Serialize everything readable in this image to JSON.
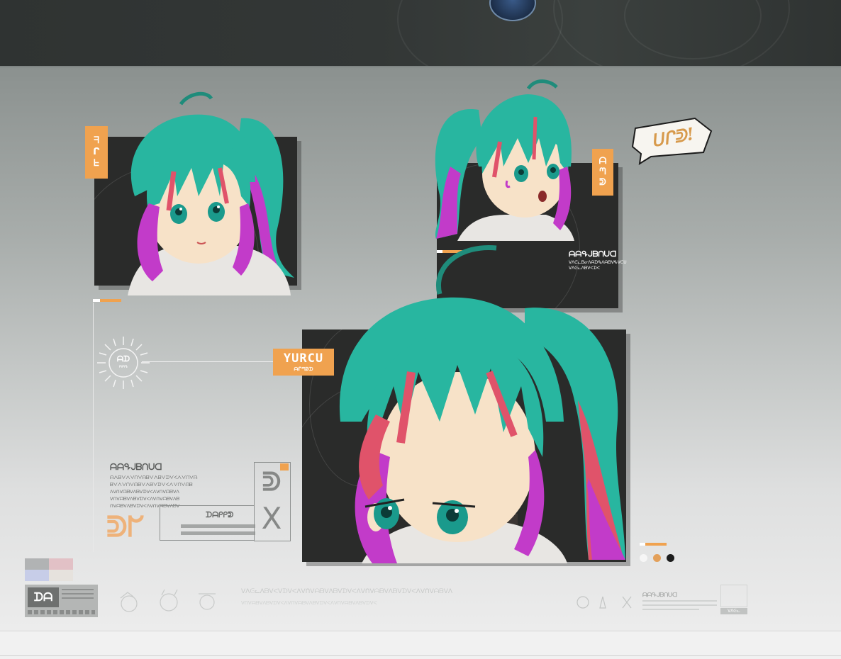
{
  "header": {
    "emblem_icon": "shield-emblem-icon"
  },
  "portrait_small_left": {
    "tag": "ᖷᒋᖶ",
    "hair_color": "#28b6a0",
    "accent_color": "#e0536a",
    "tip_color": "#c23bc9"
  },
  "portrait_small_right": {
    "tag": "ᗩᘉᕲ",
    "speech": "ᑌᒋᕲ!"
  },
  "portrait_main": {
    "tag_title": "YURCU",
    "tag_sub": "ᗩᒋᘉᕲᗪ"
  },
  "caption_top_right": {
    "title": "ᗩᗩᕴᒍᗷᑎᑌᗡ",
    "line1": "ᐯᐱᕮᓚᗷᓂᐱᗩᗪᕴᐱᗩᗷᐯᕴᐯᑕᑌ",
    "line2": "ᐯᐱᕮᓚᐱᗷᐯᐸᗪᐸ"
  },
  "side_block": {
    "title": "ᗩᗩᕴᒍᗷᑎᑌᗡ",
    "lines": [
      "ᗩᐱᗷᐯᐱᐯᑎᐯᗩᗷᐯᐱᗷᐯᗪᐯᐸᐱᐯᑎᐯᗩ",
      "ᗷᐯᐱᐯᑎᐯᗩᗷᐯᐱᗷᐯᗪᐯᐸᐱᐯᑎᐯᗩᗷ",
      "ᐱᐯᑎᐯᗩᗷᐯᐱᗷᐯᗪᐯᐸᐱᐯᑎᐯᗩᗷᐯᐱ",
      "ᐯᑎᐯᗩᗷᐯᐱᗷᐯᗪᐯᐸᐱᐯᑎᐯᗩᗷᐯᐱᗷ",
      "ᑎᐯᗩᗷᐯᐱᗷᐯᗪᐯᐸᐱᐯᑎᐯᗩᗷᐯᐱᗷᐯ"
    ],
    "box_label": "ᗪᗩᑭᑭᕲ",
    "big_mark": "ᕲᖸ",
    "glyph_a": "ᕲ",
    "glyph_b": "X"
  },
  "sun_badge": {
    "label": "ᗩᗪ",
    "sub": "ᗩᗩᕴ"
  },
  "footer": {
    "logo_text": "ᗪᗩ",
    "text_line1": "ᐯᐱᕮᓚᐱᗷᐯᐸᐯᗪᐯᐸᐱᐯᑎᐯᗩᗷᐯᐱᗷᐯᗪᐯᐸᐱᐯᑎᐯᗩᗷᐯᐱᗷᐯᗪᐯᐸᐱᐯᑎᐯᗩᗷᐯᐱ",
    "text_line2": "ᐯᑎᐯᗩᗷᐯᐱᗷᐯᗪᐯᐸᐱᐯᑎᐯᗩᗷᐯᐱᗷᐯᗪᐯᐸᐱᐯᑎᐯᗩᗷᐯᐱᗷᐯᗪᐯᐸ",
    "right_title": "ᗩᗩᕴᒍᗷᑎᑌᗡ",
    "right_badge": "ᐯᐱᕮᓚ"
  },
  "colors": {
    "orange": "#f0a24f",
    "panel": "#2a2b2a",
    "hair": "#28b6a0",
    "pink": "#e0536a",
    "purple": "#c23bc9"
  }
}
